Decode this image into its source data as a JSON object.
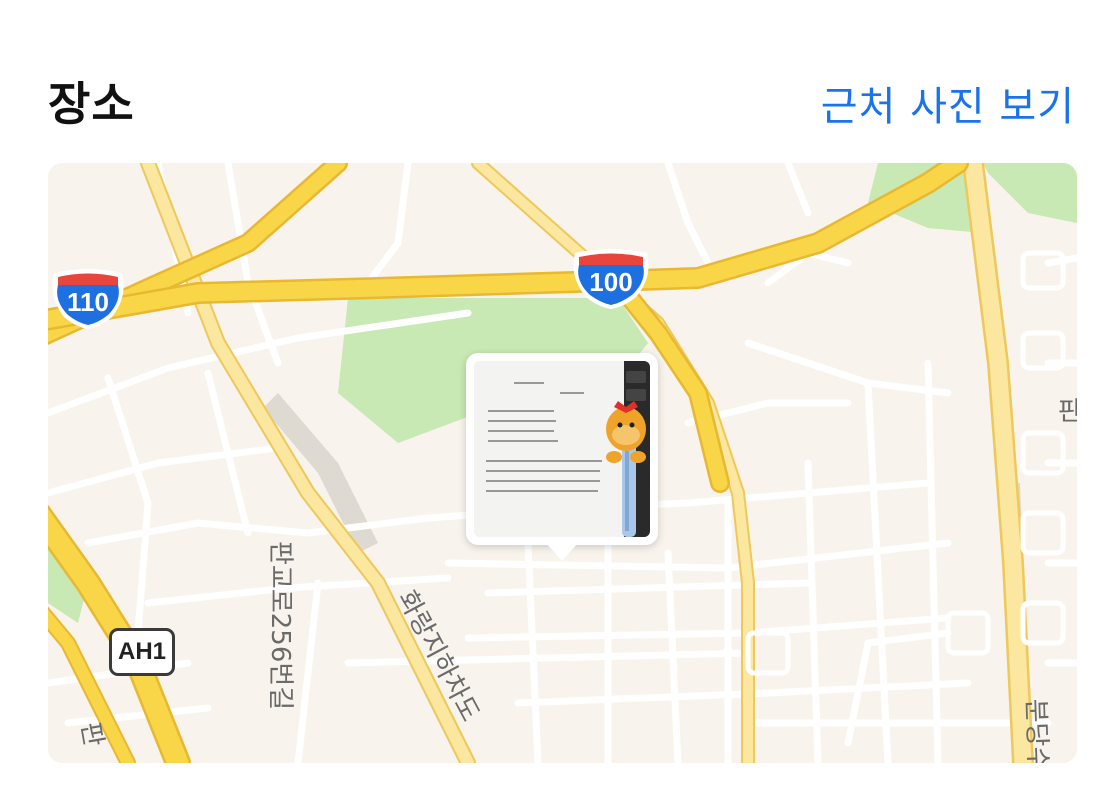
{
  "header": {
    "title": "장소",
    "nearby_link": "근처 사진 보기"
  },
  "map": {
    "shields": [
      {
        "kind": "interstate",
        "number": "110"
      },
      {
        "kind": "interstate",
        "number": "100"
      }
    ],
    "route_badge": "AH1",
    "road_labels": [
      "판교로256번길",
      "화랑지하차도",
      "판",
      "분당수",
      "판"
    ],
    "colors": {
      "land": "#f8f3ec",
      "park": "#c8e8b4",
      "highway": "#f9d648",
      "highway_edge": "#e8b830",
      "road": "#ffffff",
      "shield_blue": "#1e6fe0",
      "shield_red": "#e8463c",
      "link": "#1a73e8"
    }
  },
  "photo_pin": {
    "icon": "photo-thumbnail"
  }
}
